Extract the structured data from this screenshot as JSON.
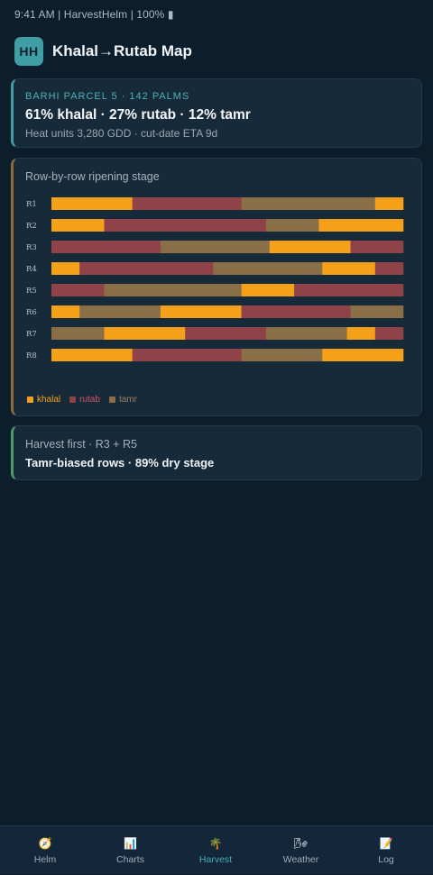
{
  "status_bar": {
    "text": "9:41 AM | HarvestHelm | 100% ▮"
  },
  "header": {
    "logo_text": "HH",
    "title": "Khalal→Rutab Map"
  },
  "summary": {
    "label": "BARHI PARCEL 5 · 142 PALMS",
    "headline": "61% khalal · 27% rutab · 12% tamr",
    "sub": "Heat units 3,280 GDD · cut-date ETA 9d"
  },
  "chart_card": {
    "heading": "Row-by-row ripening stage"
  },
  "chart_data": {
    "type": "bar",
    "orientation": "horizontal-stacked-segments",
    "title": "Row-by-row ripening stage",
    "stage_colors": {
      "khalal": "#f5a019",
      "rutab": "#8f4248",
      "tamr": "#8a6e46"
    },
    "legend": [
      {
        "name": "khalal",
        "color": "#f5a019"
      },
      {
        "name": "rutab",
        "color": "#d0575b"
      },
      {
        "name": "tamr",
        "color": "#97805c"
      }
    ],
    "rows": [
      {
        "label": "R1",
        "segments": [
          {
            "stage": "khalal",
            "share": 0.23
          },
          {
            "stage": "rutab",
            "share": 0.31
          },
          {
            "stage": "tamr",
            "share": 0.38
          },
          {
            "stage": "khalal",
            "share": 0.08
          }
        ]
      },
      {
        "label": "R2",
        "segments": [
          {
            "stage": "khalal",
            "share": 0.15
          },
          {
            "stage": "rutab",
            "share": 0.46
          },
          {
            "stage": "tamr",
            "share": 0.15
          },
          {
            "stage": "khalal",
            "share": 0.24
          }
        ]
      },
      {
        "label": "R3",
        "segments": [
          {
            "stage": "rutab",
            "share": 0.31
          },
          {
            "stage": "tamr",
            "share": 0.31
          },
          {
            "stage": "khalal",
            "share": 0.23
          },
          {
            "stage": "rutab",
            "share": 0.15
          }
        ]
      },
      {
        "label": "R4",
        "segments": [
          {
            "stage": "khalal",
            "share": 0.08
          },
          {
            "stage": "rutab",
            "share": 0.38
          },
          {
            "stage": "tamr",
            "share": 0.31
          },
          {
            "stage": "khalal",
            "share": 0.15
          },
          {
            "stage": "rutab",
            "share": 0.08
          }
        ]
      },
      {
        "label": "R5",
        "segments": [
          {
            "stage": "rutab",
            "share": 0.15
          },
          {
            "stage": "tamr",
            "share": 0.39
          },
          {
            "stage": "khalal",
            "share": 0.15
          },
          {
            "stage": "rutab",
            "share": 0.31
          }
        ]
      },
      {
        "label": "R6",
        "segments": [
          {
            "stage": "khalal",
            "share": 0.08
          },
          {
            "stage": "tamr",
            "share": 0.23
          },
          {
            "stage": "khalal",
            "share": 0.23
          },
          {
            "stage": "rutab",
            "share": 0.31
          },
          {
            "stage": "tamr",
            "share": 0.15
          }
        ]
      },
      {
        "label": "R7",
        "segments": [
          {
            "stage": "tamr",
            "share": 0.15
          },
          {
            "stage": "khalal",
            "share": 0.23
          },
          {
            "stage": "rutab",
            "share": 0.23
          },
          {
            "stage": "tamr",
            "share": 0.23
          },
          {
            "stage": "khalal",
            "share": 0.08
          },
          {
            "stage": "rutab",
            "share": 0.08
          }
        ]
      },
      {
        "label": "R8",
        "segments": [
          {
            "stage": "khalal",
            "share": 0.23
          },
          {
            "stage": "rutab",
            "share": 0.31
          },
          {
            "stage": "tamr",
            "share": 0.23
          },
          {
            "stage": "khalal",
            "share": 0.23
          }
        ]
      }
    ]
  },
  "action": {
    "label": "Harvest first · R3 + R5",
    "text": "Tamr-biased rows · 89% dry stage"
  },
  "nav": {
    "items": [
      {
        "label": "Helm",
        "icon": "🧭",
        "icon_name": "compass-icon",
        "active": false
      },
      {
        "label": "Charts",
        "icon": "📊",
        "icon_name": "bar-chart-icon",
        "active": false
      },
      {
        "label": "Harvest",
        "icon": "🌴",
        "icon_name": "palm-tree-icon",
        "active": true
      },
      {
        "label": "Weather",
        "icon": "🌬",
        "icon_name": "wind-icon",
        "active": false
      },
      {
        "label": "Log",
        "icon": "📝",
        "icon_name": "memo-icon",
        "active": false
      }
    ]
  }
}
